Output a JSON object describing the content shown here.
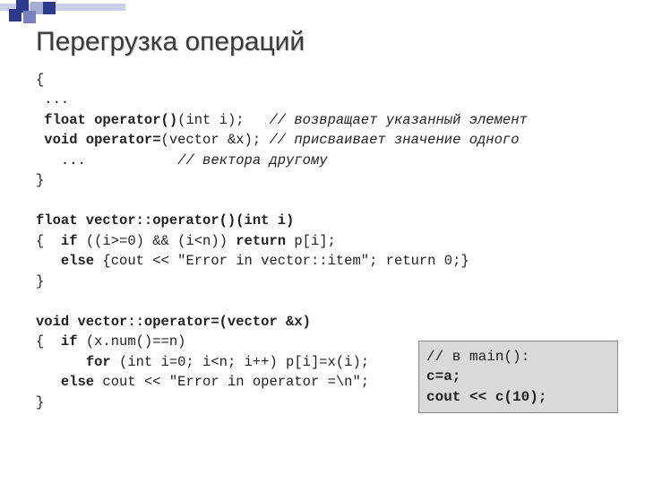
{
  "title": "Перегрузка операций",
  "code": {
    "l1": "{",
    "l2": " ...",
    "l3a": " float operator()",
    "l3b": "(int i);   ",
    "l3c": "// возвращает указанный элемент",
    "l4a": " void operator=",
    "l4b": "(vector &x); ",
    "l4c": "// присваивает значение одного",
    "l5": "   ...           ",
    "l5c": "// вектора другому",
    "l6": "}",
    "l7": "",
    "l8": "float vector::operator()(int i)",
    "l9a": "{  ",
    "l9b": "if",
    "l9c": " ((i>=0) && (i<n)) ",
    "l9d": "return",
    "l9e": " p[i];",
    "l10a": "   ",
    "l10b": "else",
    "l10c": " {cout << \"Error in vector::item\"; return 0;}",
    "l11": "}",
    "l12": "",
    "l13": "void vector::operator=(vector &x)",
    "l14a": "{  ",
    "l14b": "if",
    "l14c": " (x.num()==n)",
    "l15a": "      ",
    "l15b": "for",
    "l15c": " (int i=0; i<n; i++) p[i]=x(i);",
    "l16a": "   ",
    "l16b": "else",
    "l16c": " cout << \"Error in operator =\\n\";",
    "l17": "}"
  },
  "mainbox": {
    "l1": "// в main():",
    "l2": "c=a;",
    "l3": "cout << c(10);"
  }
}
